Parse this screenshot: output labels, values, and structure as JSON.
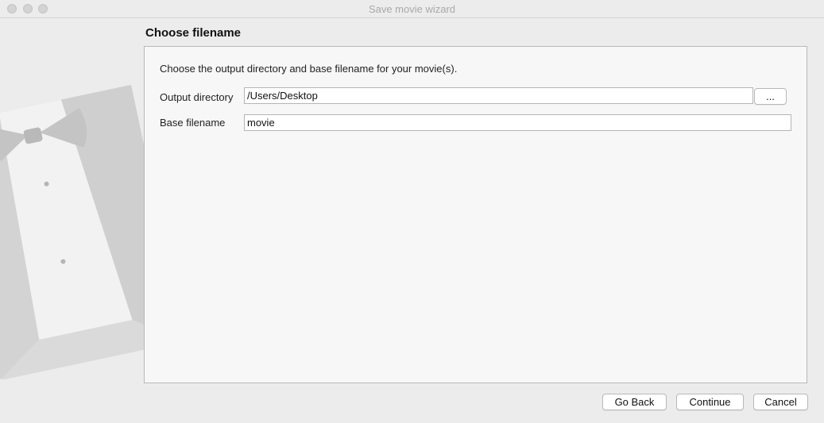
{
  "window": {
    "title": "Save movie wizard"
  },
  "page": {
    "title": "Choose filename",
    "description": "Choose the output directory and base filename for your movie(s)."
  },
  "fields": {
    "output_directory": {
      "label": "Output directory",
      "value": "/Users/Desktop"
    },
    "base_filename": {
      "label": "Base filename",
      "value": "movie"
    }
  },
  "browse_button": {
    "label": "..."
  },
  "footer": {
    "back_label": "Go Back",
    "continue_label": "Continue",
    "cancel_label": "Cancel"
  },
  "icons": {
    "watermark": "tuxedo-bowtie-icon",
    "window_controls": [
      "close-icon",
      "minimize-icon",
      "zoom-icon"
    ]
  }
}
